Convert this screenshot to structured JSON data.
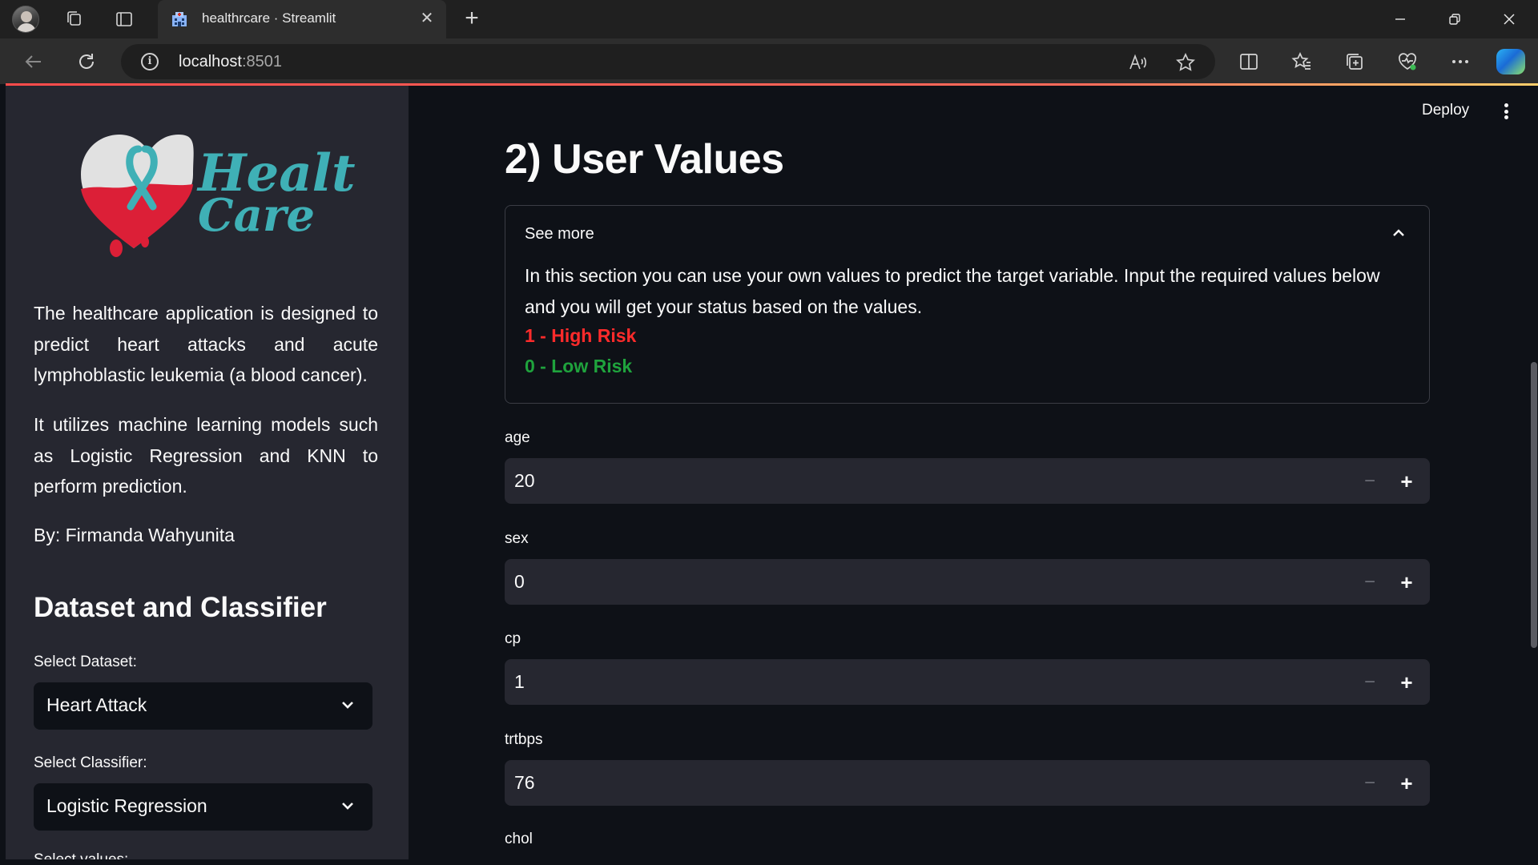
{
  "browser": {
    "tab_title": "healthrcare · Streamlit",
    "url_host": "localhost",
    "url_port": ":8501"
  },
  "sidebar": {
    "logo_text_line1": "Health",
    "logo_text_line2": "Care",
    "paragraph1": "The healthcare application is designed to predict heart attacks and acute lymphoblastic leukemia (a blood cancer).",
    "paragraph2": "It utilizes machine learning models such as Logistic Regression and KNN to perform prediction.",
    "author": "By: Firmanda Wahyunita",
    "section_title": "Dataset and Classifier",
    "dataset_label": "Select Dataset:",
    "dataset_value": "Heart Attack",
    "classifier_label": "Select Classifier:",
    "classifier_value": "Logistic Regression",
    "cut_label": "Select values:"
  },
  "header": {
    "deploy_label": "Deploy"
  },
  "main": {
    "title": "2) User Values",
    "expander": {
      "label": "See more",
      "body": "In this section you can use your own values to predict the target variable. Input the required values below and you will get your status based on the values.",
      "high_risk": "1 - High Risk",
      "low_risk": "0 - Low Risk"
    },
    "fields": [
      {
        "label": "age",
        "value": "20"
      },
      {
        "label": "sex",
        "value": "0"
      },
      {
        "label": "cp",
        "value": "1"
      },
      {
        "label": "trtbps",
        "value": "76"
      },
      {
        "label": "chol",
        "value": ""
      }
    ]
  },
  "colors": {
    "accent": "#ff4b4b",
    "high_risk": "#ff2b2b",
    "low_risk": "#1fa33d",
    "sidebar_bg": "#262730",
    "page_bg": "#0e1117"
  }
}
